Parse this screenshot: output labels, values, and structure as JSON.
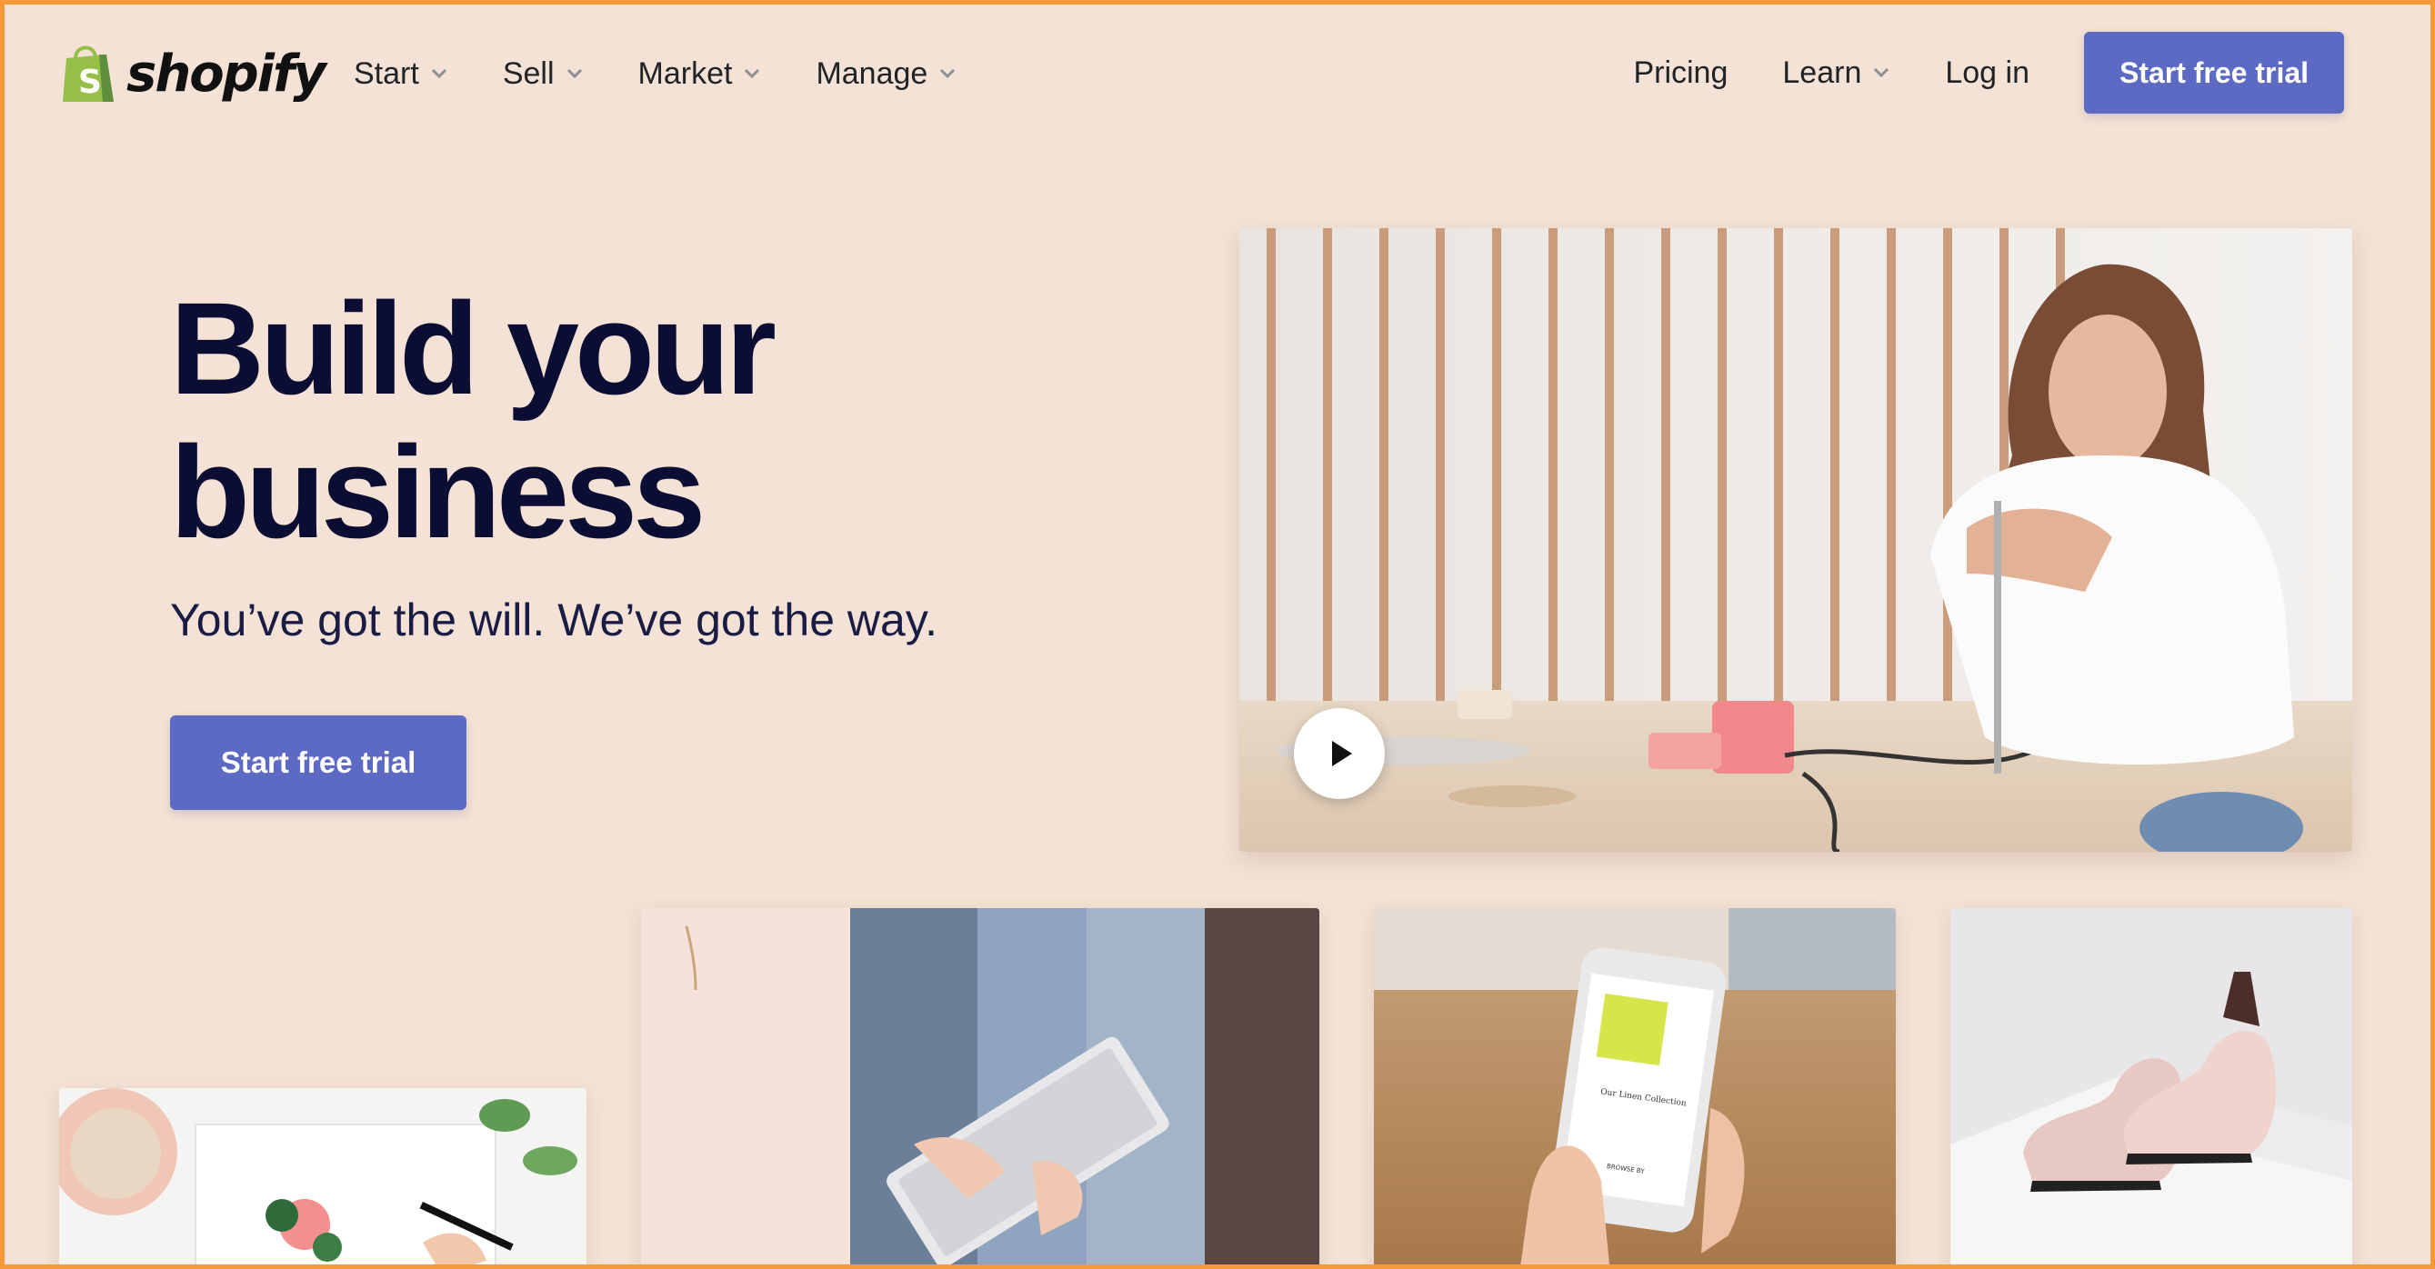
{
  "nav": {
    "logo_text": "shopify",
    "left_items": [
      {
        "label": "Start"
      },
      {
        "label": "Sell"
      },
      {
        "label": "Market"
      },
      {
        "label": "Manage"
      }
    ],
    "pricing": "Pricing",
    "learn": "Learn",
    "login": "Log in",
    "cta": "Start free trial"
  },
  "hero": {
    "title_line1": "Build your",
    "title_line2": "business",
    "subtitle": "You’ve got the will. We’ve got the way.",
    "cta": "Start free trial"
  },
  "images": {
    "video": "woman-crafting-video-thumbnail",
    "tile1": "notebook-sketch-photo",
    "tile2": "tablet-clothing-rack-photo",
    "tile3": "phone-store-photo",
    "tile4": "shoes-photo"
  },
  "colors": {
    "background": "#f3e2d5",
    "accent": "#5c6ac4",
    "heading": "#0c0d33",
    "border": "#f49a3a"
  },
  "phone_screen": {
    "heading": "Our Linen Collection",
    "button": "BROWSE BY"
  }
}
